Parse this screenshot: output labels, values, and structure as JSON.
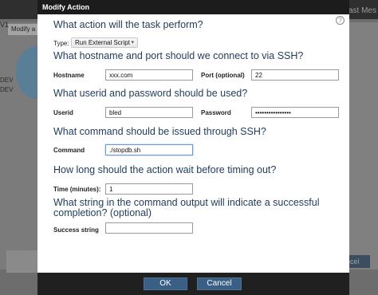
{
  "background": {
    "topbar_text": "Last Mes",
    "panel_header": "Modify a",
    "left_label_1": "V1",
    "left_label_2": "DEV",
    "left_label_3": "DEV",
    "right_button": "ncel"
  },
  "modal": {
    "title": "Modify Action",
    "help_icon": "?",
    "sections": {
      "task": "What action will the task perform?",
      "host": "What hostname and port should we connect to via SSH?",
      "creds": "What userid and password should be used?",
      "command": "What command should be issued through SSH?",
      "timeout": "How long should the action wait before timing out?",
      "success_line1": "What string in the command output will indicate a successful",
      "success_line2": "completion? (optional)"
    },
    "fields": {
      "type_label": "Type:",
      "type_value": "Run External Script",
      "hostname_label": "Hostname",
      "hostname_value": "xxx.com",
      "port_label": "Port (optional)",
      "port_value": "22",
      "userid_label": "Userid",
      "userid_value": "bled",
      "password_label": "Password",
      "password_value": "••••••••••••••••",
      "command_label": "Command",
      "command_value": "./stopdb.sh",
      "time_label": "Time (minutes):",
      "time_value": "1",
      "success_label": "Success string",
      "success_value": ""
    },
    "buttons": {
      "ok": "OK",
      "cancel": "Cancel"
    }
  },
  "colors": {
    "heading": "#1f3b5a",
    "button": "#3a5f84",
    "titlebar": "#1c1c1c"
  }
}
